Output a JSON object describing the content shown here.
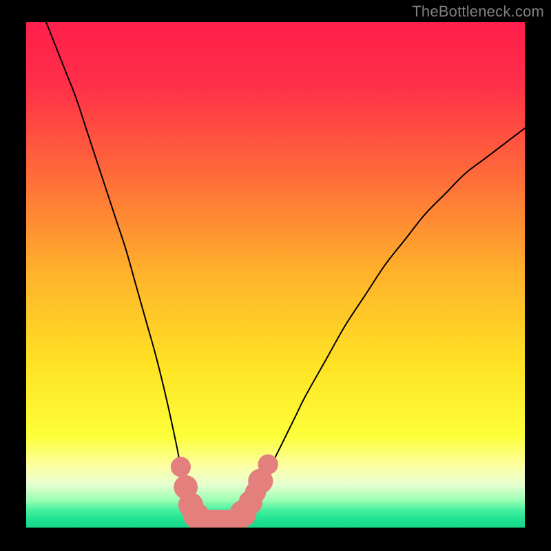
{
  "watermark": "TheBottleneck.com",
  "colors": {
    "frame": "#000000",
    "gradient_stops": [
      {
        "offset": 0.0,
        "color": "#ff1f4b"
      },
      {
        "offset": 0.12,
        "color": "#ff2e49"
      },
      {
        "offset": 0.3,
        "color": "#ff6a3a"
      },
      {
        "offset": 0.5,
        "color": "#ffb32a"
      },
      {
        "offset": 0.68,
        "color": "#ffe324"
      },
      {
        "offset": 0.82,
        "color": "#fdff3a"
      },
      {
        "offset": 0.88,
        "color": "#fbffa6"
      },
      {
        "offset": 0.915,
        "color": "#e6ffd0"
      },
      {
        "offset": 0.945,
        "color": "#9effb4"
      },
      {
        "offset": 0.965,
        "color": "#46f09f"
      },
      {
        "offset": 0.985,
        "color": "#1ce28f"
      },
      {
        "offset": 1.0,
        "color": "#17d688"
      }
    ],
    "curve": "#000000",
    "markers_fill": "#e37f7d",
    "markers_stroke": "#c85f5c"
  },
  "chart_data": {
    "type": "line",
    "title": "",
    "xlabel": "",
    "ylabel": "",
    "xlim": [
      0,
      100
    ],
    "ylim": [
      0,
      100
    ],
    "series": [
      {
        "name": "bottleneck-curve",
        "x": [
          4,
          6,
          8,
          10,
          12,
          14,
          16,
          18,
          20,
          22,
          24,
          26,
          28,
          30,
          31,
          32,
          33,
          34,
          35,
          36,
          38,
          40,
          42,
          44,
          46,
          48,
          50,
          52,
          54,
          56,
          60,
          64,
          68,
          72,
          76,
          80,
          84,
          88,
          92,
          96,
          100
        ],
        "y": [
          100,
          95,
          90,
          85,
          79,
          73,
          67,
          61,
          55,
          48,
          41,
          34,
          26,
          17,
          12,
          8,
          5,
          3,
          1.5,
          1,
          1,
          1,
          1.5,
          3,
          6,
          10,
          14,
          18,
          22,
          26,
          33,
          40,
          46,
          52,
          57,
          62,
          66,
          70,
          73,
          76,
          79
        ]
      }
    ],
    "markers": {
      "name": "highlighted-points",
      "points": [
        {
          "x": 31.0,
          "y": 12.0,
          "r": 1.4
        },
        {
          "x": 32.0,
          "y": 8.0,
          "r": 1.8
        },
        {
          "x": 33.0,
          "y": 4.5,
          "r": 1.9
        },
        {
          "x": 34.0,
          "y": 2.5,
          "r": 2.0
        },
        {
          "x": 35.0,
          "y": 1.5,
          "r": 2.0
        },
        {
          "x": 36.0,
          "y": 1.0,
          "r": 2.0
        },
        {
          "x": 37.5,
          "y": 1.0,
          "r": 2.0
        },
        {
          "x": 39.0,
          "y": 1.0,
          "r": 2.0
        },
        {
          "x": 40.5,
          "y": 1.0,
          "r": 2.0
        },
        {
          "x": 42.0,
          "y": 1.3,
          "r": 2.0
        },
        {
          "x": 43.5,
          "y": 2.8,
          "r": 2.1
        },
        {
          "x": 45.0,
          "y": 5.0,
          "r": 1.8
        },
        {
          "x": 46.0,
          "y": 7.0,
          "r": 1.5
        },
        {
          "x": 47.0,
          "y": 9.2,
          "r": 1.9
        },
        {
          "x": 48.5,
          "y": 12.5,
          "r": 1.4
        }
      ]
    }
  }
}
